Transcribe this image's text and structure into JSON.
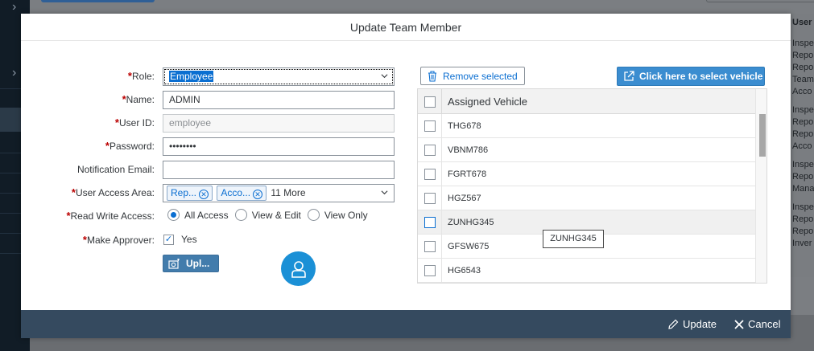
{
  "dialog": {
    "title": "Update Team Member"
  },
  "form": {
    "role": {
      "label": "Role:",
      "required": "*",
      "value": "Employee"
    },
    "name": {
      "label": "Name:",
      "required": "*",
      "value": "ADMIN"
    },
    "user_id": {
      "label": "User ID:",
      "required": "*",
      "value": "employee"
    },
    "password": {
      "label": "Password:",
      "required": "*",
      "value": "••••••••"
    },
    "notification_email": {
      "label": "Notification Email:",
      "value": ""
    },
    "user_access_area": {
      "label": "User Access Area:",
      "required": "*",
      "tokens": [
        "Rep...",
        "Acco..."
      ],
      "more": "11 More"
    },
    "read_write_access": {
      "label": "Read Write Access:",
      "required": "*",
      "options": [
        "All Access",
        "View & Edit",
        "View Only"
      ],
      "selected": "All Access"
    },
    "make_approver": {
      "label": "Make Approver:",
      "required": "*",
      "checked": true,
      "option_label": "Yes"
    },
    "upload_button": "Upl..."
  },
  "vehicles": {
    "remove_button": "Remove selected",
    "select_button": "Click here to select vehicle",
    "column_header": "Assigned Vehicle",
    "rows": [
      "THG678",
      "VBNM786",
      "FGRT678",
      "HGZ567",
      "ZUNHG345",
      "GFSW675",
      "HG6543"
    ],
    "hovered_row": "ZUNHG345",
    "tooltip": "ZUNHG345"
  },
  "footer": {
    "update": "Update",
    "cancel": "Cancel"
  },
  "background": {
    "right_header": "User",
    "right_items": [
      "Inspe",
      "Repo",
      "Repo",
      "Team",
      "Acco",
      "",
      "Inspe",
      "Repo",
      "Repo",
      "Acco",
      "",
      "Inspe",
      "Repo",
      "Mana",
      "",
      "Inspe",
      "Repo",
      "Repo",
      "Inver"
    ]
  },
  "colors": {
    "accent": "#0a6ed1",
    "footer_bg": "#354a5f",
    "required": "#bb0000",
    "avatar": "#1b90d6"
  }
}
